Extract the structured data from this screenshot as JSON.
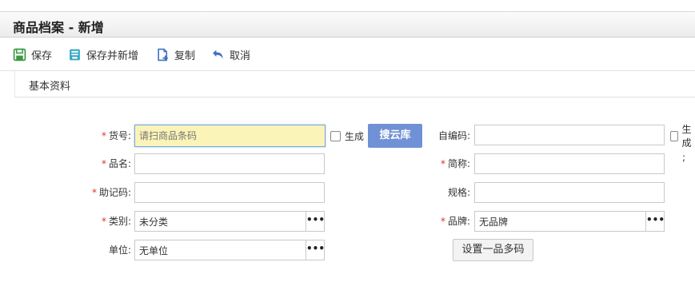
{
  "window": {
    "title": "商品档案 - 新增"
  },
  "toolbar": {
    "save": "保存",
    "save_new": "保存并新增",
    "copy": "复制",
    "cancel": "取消"
  },
  "section": {
    "title": "基本资料"
  },
  "form": {
    "code": {
      "label": "货号:",
      "placeholder": "请扫商品条码",
      "value": ""
    },
    "generate1": "生成",
    "cloud_search": "搜云库",
    "self_code": {
      "label": "自编码:",
      "value": ""
    },
    "generate2": "生成",
    "name": {
      "label": "品名:",
      "value": ""
    },
    "short_name": {
      "label": "简称:",
      "value": ""
    },
    "mnemonic": {
      "label": "助记码:",
      "value": ""
    },
    "spec": {
      "label": "规格:",
      "value": ""
    },
    "category": {
      "label": "类别:",
      "value": "未分类"
    },
    "brand": {
      "label": "品牌:",
      "value": "无品牌"
    },
    "unit": {
      "label": "单位:",
      "value": "无单位"
    },
    "multi_code": "设置一品多码",
    "lookup_glyph": "•••",
    "required_mark": "*",
    "stray_text": ";"
  },
  "colors": {
    "accent_button": "#7191d6",
    "highlight_input": "#fbf4b8",
    "required": "#d9322b",
    "save_icon": "#3a9a43",
    "save_new_icon": "#34a8c4",
    "copy_icon": "#3d72c4",
    "cancel_icon": "#3d72c4"
  }
}
